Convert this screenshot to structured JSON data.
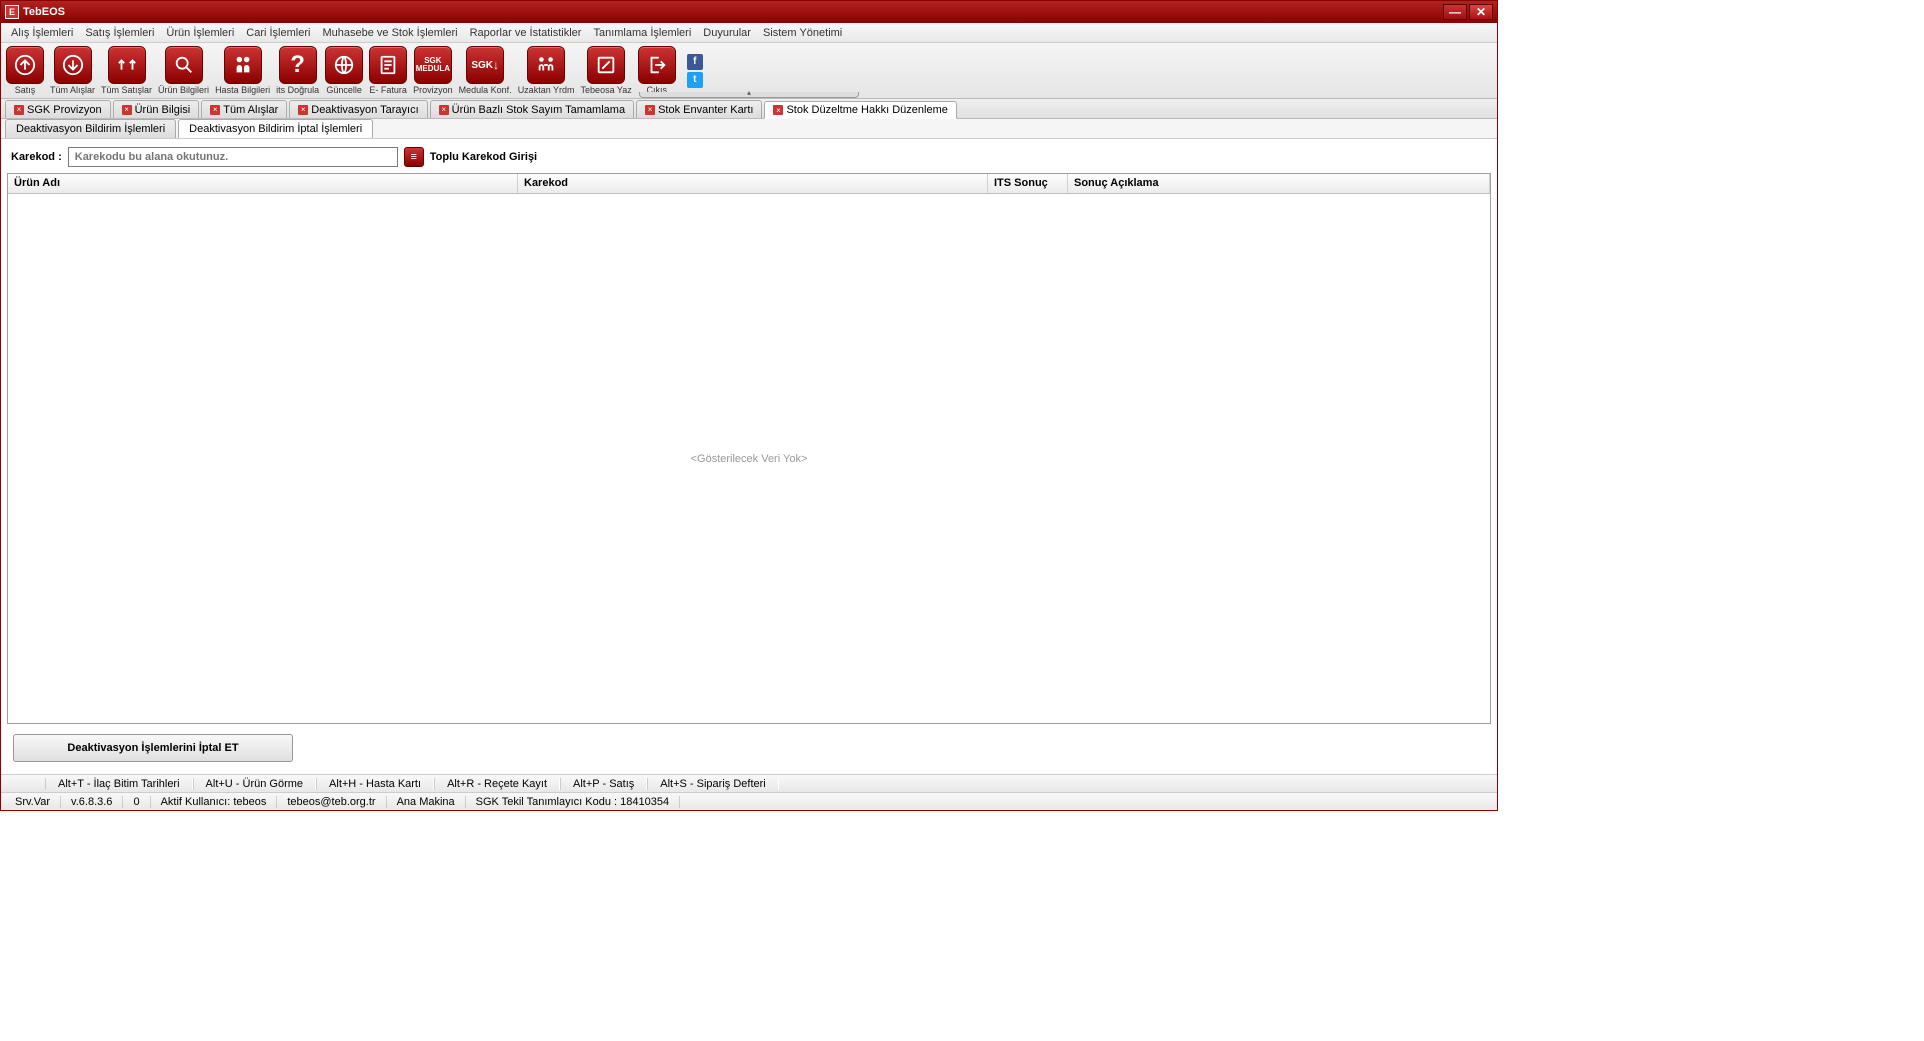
{
  "window": {
    "title": "TebEOS",
    "logo_letter": "E"
  },
  "menubar": [
    "Alış İşlemleri",
    "Satış İşlemleri",
    "Ürün İşlemleri",
    "Cari İşlemleri",
    "Muhasebe ve Stok İşlemleri",
    "Raporlar ve İstatistikler",
    "Tanımlama İşlemleri",
    "Duyurular",
    "Sistem Yönetimi"
  ],
  "toolbar": [
    {
      "label": "Satış",
      "glyph": "↑"
    },
    {
      "label": "Tüm Alışlar",
      "glyph": "↓"
    },
    {
      "label": "Tüm Satışlar",
      "glyph": "⇈"
    },
    {
      "label": "Ürün Bilgileri",
      "glyph": "🔍"
    },
    {
      "label": "Hasta Bilgileri",
      "glyph": "👥"
    },
    {
      "label": "its Doğrula",
      "glyph": "?"
    },
    {
      "label": "Güncelle",
      "glyph": "⟳"
    },
    {
      "label": "E- Fatura",
      "glyph": "▤"
    },
    {
      "label": "Provizyon",
      "glyph": "SGK"
    },
    {
      "label": "Medula Konf.",
      "glyph": "SGK"
    },
    {
      "label": "Uzaktan Yrdm",
      "glyph": "⇅"
    },
    {
      "label": "Tebeosa Yaz",
      "glyph": "✎"
    },
    {
      "label": "Çıkış",
      "glyph": "⇥"
    }
  ],
  "doc_tabs": [
    {
      "label": "SGK Provizyon",
      "active": false
    },
    {
      "label": "Ürün Bilgisi",
      "active": false
    },
    {
      "label": "Tüm Alışlar",
      "active": false
    },
    {
      "label": "Deaktivasyon Tarayıcı",
      "active": false
    },
    {
      "label": "Ürün Bazlı Stok Sayım Tamamlama",
      "active": false
    },
    {
      "label": "Stok Envanter Kartı",
      "active": false
    },
    {
      "label": "Stok Düzeltme Hakkı Düzenleme",
      "active": true
    }
  ],
  "sub_tabs": [
    {
      "label": "Deaktivasyon Bildirim İşlemleri",
      "active": false
    },
    {
      "label": "Deaktivasyon Bildirim İptal İşlemleri",
      "active": true
    }
  ],
  "form": {
    "karekod_label": "Karekod :",
    "karekod_placeholder": "Karekodu bu alana okutunuz.",
    "toplu_label": "Toplu Karekod Girişi"
  },
  "grid": {
    "columns": {
      "urun": "Ürün Adı",
      "karekod": "Karekod",
      "its": "ITS Sonuç",
      "sonuc": "Sonuç Açıklama"
    },
    "empty_text": "<Gösterilecek Veri Yok>"
  },
  "action_button": "Deaktivasyon İşlemlerini İptal ET",
  "shortcuts": [
    "Alt+T - İlaç Bitim Tarihleri",
    "Alt+U - Ürün Görme",
    "Alt+H -  Hasta Kartı",
    "Alt+R - Reçete Kayıt",
    "Alt+P - Satış",
    "Alt+S - Sipariş Defteri"
  ],
  "status": {
    "srv": "Srv.Var",
    "version": "v.6.8.3.6",
    "zero": "0",
    "user": "Aktif Kullanıcı: tebeos",
    "email": "tebeos@teb.org.tr",
    "makina": "Ana Makina",
    "kod": "SGK Tekil Tanımlayıcı Kodu : 18410354"
  }
}
